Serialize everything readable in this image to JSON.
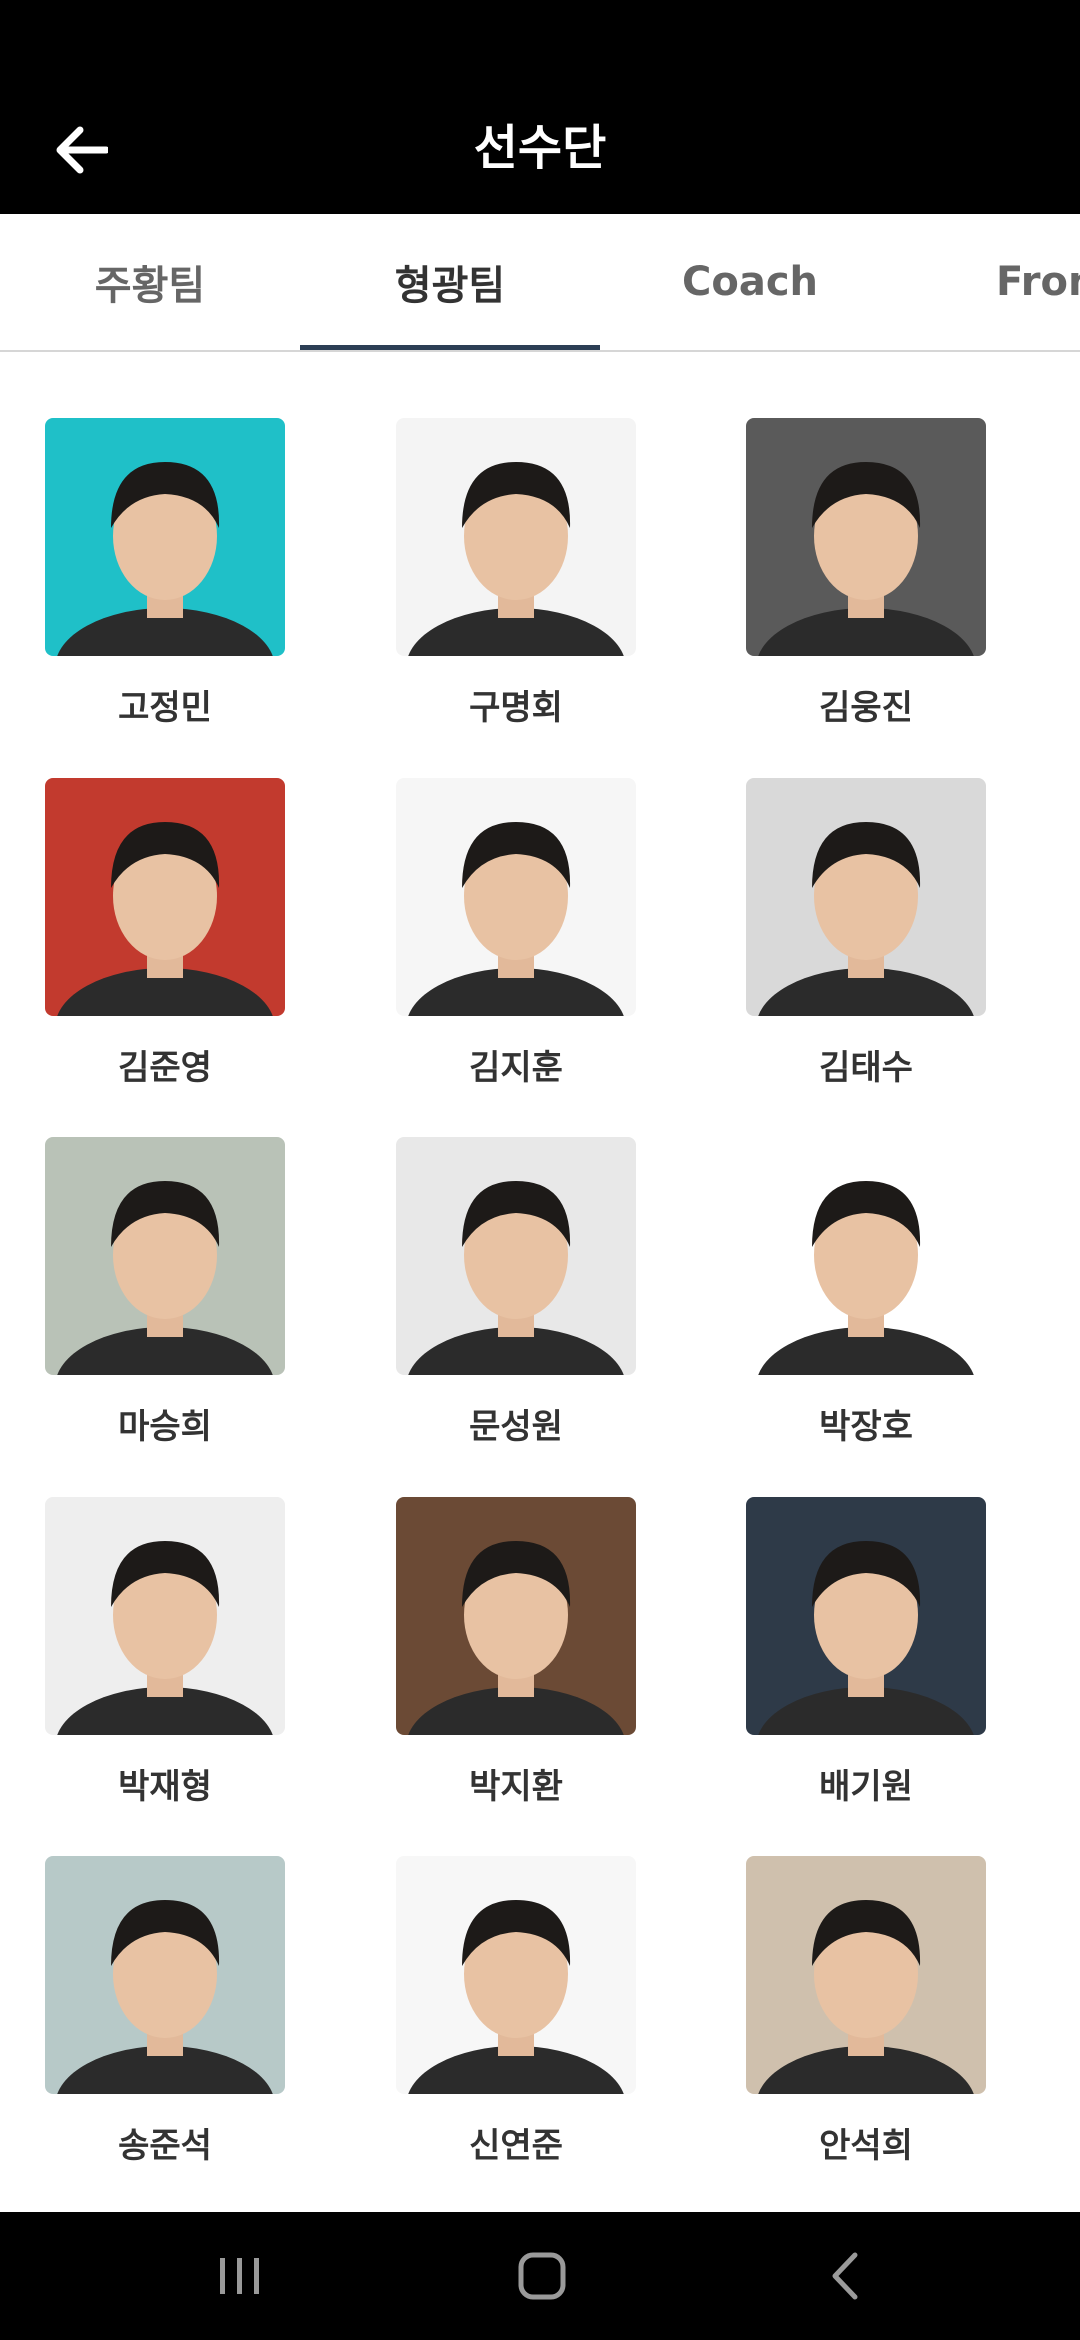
{
  "appbar": {
    "title": "선수단",
    "back_icon": "arrow-left-icon"
  },
  "tabs": [
    {
      "label": "주황팀",
      "active": false
    },
    {
      "label": "형광팀",
      "active": true
    },
    {
      "label": "Coach",
      "active": false
    },
    {
      "label": "Front",
      "active": false
    }
  ],
  "players": [
    {
      "name": "고정민",
      "bg": "#1fc0c8"
    },
    {
      "name": "구명회",
      "bg": "#f4f4f4"
    },
    {
      "name": "김웅진",
      "bg": "#5a5a5a"
    },
    {
      "name": "김준영",
      "bg": "#c23a2e"
    },
    {
      "name": "김지훈",
      "bg": "#f6f6f6"
    },
    {
      "name": "김태수",
      "bg": "#d9d9d9"
    },
    {
      "name": "마승희",
      "bg": "#b9c2b7"
    },
    {
      "name": "문성원",
      "bg": "#e8e8e8"
    },
    {
      "name": "박장호",
      "bg": "#ffffff"
    },
    {
      "name": "박재형",
      "bg": "#eeeeee"
    },
    {
      "name": "박지환",
      "bg": "#6b4a35"
    },
    {
      "name": "배기원",
      "bg": "#2e3a48"
    },
    {
      "name": "송준석",
      "bg": "#b7c9c8"
    },
    {
      "name": "신연준",
      "bg": "#f7f7f7"
    },
    {
      "name": "안석희",
      "bg": "#cfc0ad"
    }
  ],
  "navbar": {
    "recent_icon": "recent-apps-icon",
    "home_icon": "home-icon",
    "back_icon": "back-chevron-icon"
  }
}
